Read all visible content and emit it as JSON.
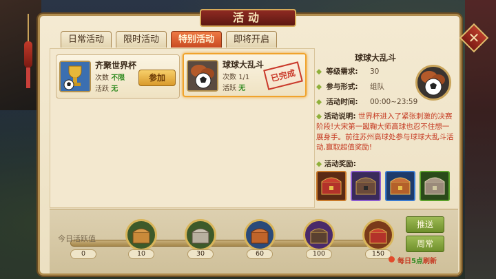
{
  "window": {
    "title": "活动"
  },
  "tabs": [
    {
      "label": "日常活动",
      "active": false
    },
    {
      "label": "限时活动",
      "active": false
    },
    {
      "label": "特别活动",
      "active": true
    },
    {
      "label": "即将开启",
      "active": false
    }
  ],
  "activities": [
    {
      "title": "齐聚世界杯",
      "count_label": "次数",
      "count_value": "不限",
      "activity_label": "活跃",
      "activity_value": "无",
      "action_label": "参加",
      "icon": "trophy-icon"
    },
    {
      "title": "球球大乱斗",
      "count_label": "次数",
      "count_value": "1/1",
      "activity_label": "活跃",
      "activity_value": "无",
      "stamp_label": "已完成",
      "icon": "soccer-ball-icon"
    }
  ],
  "detail": {
    "title": "球球大乱斗",
    "level_label": "等级需求:",
    "level_value": "30",
    "form_label": "参与形式:",
    "form_value": "组队",
    "time_label": "活动时间:",
    "time_value": "00:00~23:59",
    "desc_label": "活动说明:",
    "desc_text": "世界杯进入了紧张刺激的决赛阶段!大宋第一蹴鞠大师高球也忍不住想一展身手。前往苏州高球处参与球球大乱斗活动,赢取超值奖励!",
    "rewards_label": "活动奖励:",
    "rewards": [
      {
        "icon": "red-chest-icon",
        "color": "#c9792a"
      },
      {
        "icon": "purple-chest-icon",
        "color": "#8a5ad0"
      },
      {
        "icon": "blue-chest-icon",
        "color": "#3a7ad0"
      },
      {
        "icon": "green-chest-icon",
        "color": "#5aa02a"
      }
    ]
  },
  "progress": {
    "label": "今日活跃值",
    "value": "0",
    "milestones": [
      {
        "value": "10",
        "icon": "wood-chest-icon"
      },
      {
        "value": "30",
        "icon": "silver-chest-icon"
      },
      {
        "value": "60",
        "icon": "bronze-chest-icon"
      },
      {
        "value": "100",
        "icon": "dark-chest-icon"
      },
      {
        "value": "150",
        "icon": "red-chest-icon"
      }
    ]
  },
  "actions": {
    "push_label": "推送",
    "weekly_label": "周常"
  },
  "refresh": {
    "text_before": "每日",
    "highlight": "5点",
    "text_after": "刷新"
  }
}
